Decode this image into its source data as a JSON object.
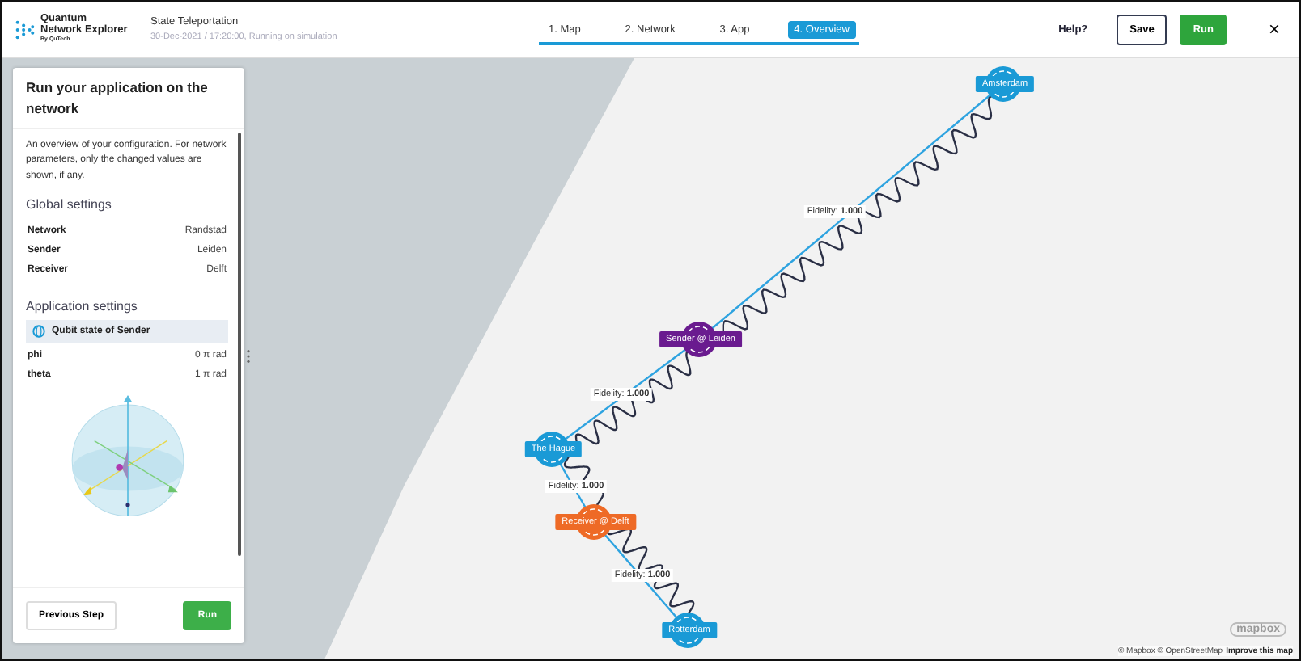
{
  "header": {
    "logo": {
      "line1": "Quantum",
      "line2": "Network Explorer",
      "line3": "By QuTech"
    },
    "title": "State Teleportation",
    "subtitle": "30-Dec-2021 / 17:20:00, Running on simulation",
    "steps": [
      {
        "label": "1. Map",
        "selected": false
      },
      {
        "label": "2. Network",
        "selected": false
      },
      {
        "label": "3. App",
        "selected": false
      },
      {
        "label": "4. Overview",
        "selected": true
      }
    ],
    "help": "Help?",
    "save": "Save",
    "run": "Run",
    "close": "×"
  },
  "sidebar": {
    "title": "Run your application on the network",
    "description": "An overview of your configuration. For network parameters, only the changed values are shown, if any.",
    "global_heading": "Global settings",
    "global_rows": [
      {
        "name": "Network",
        "value": "Randstad"
      },
      {
        "name": "Sender",
        "value": "Leiden"
      },
      {
        "name": "Receiver",
        "value": "Delft"
      }
    ],
    "app_heading": "Application settings",
    "qubit_title": "Qubit state of Sender",
    "params": [
      {
        "name": "phi",
        "value": "0 π rad"
      },
      {
        "name": "theta",
        "value": "1 π rad"
      }
    ],
    "previous": "Previous Step",
    "run": "Run"
  },
  "map": {
    "nodes": [
      {
        "label": "Amsterdam",
        "color": "#1a9ad6"
      },
      {
        "label": "Sender @ Leiden",
        "color": "#6a1b8f"
      },
      {
        "label": "The Hague",
        "color": "#1a9ad6"
      },
      {
        "label": "Receiver @ Delft",
        "color": "#ee6a26"
      },
      {
        "label": "Rotterdam",
        "color": "#1a9ad6"
      }
    ],
    "links": [
      {
        "fidelity": "Fidelity: **1.000**"
      },
      {
        "fidelity": "Fidelity: **1.000**"
      },
      {
        "fidelity": "Fidelity: **1.000**"
      },
      {
        "fidelity": "Fidelity: **1.000**"
      }
    ],
    "logo": "mapbox",
    "attribution": "© Mapbox © OpenStreetMap",
    "improve": "Improve this map"
  }
}
